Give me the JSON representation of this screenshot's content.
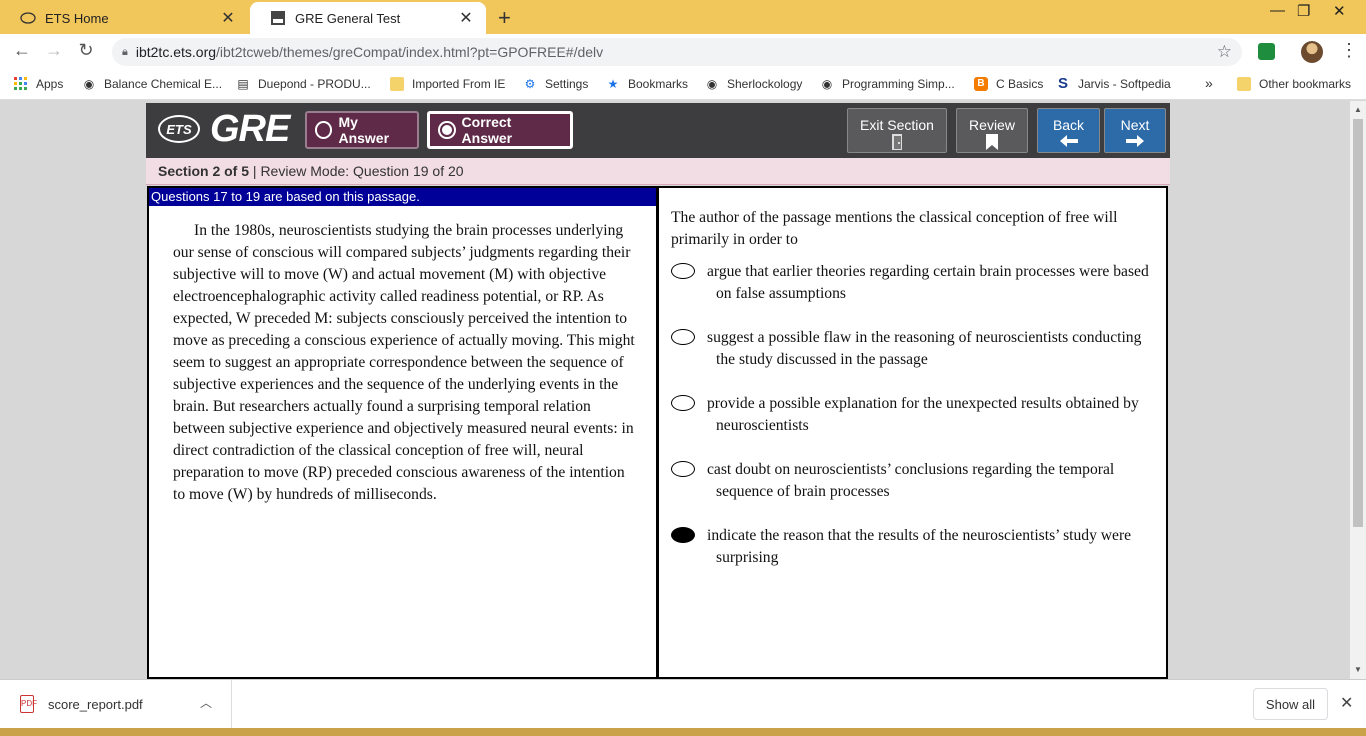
{
  "browser": {
    "tabs": [
      {
        "title": "ETS Home",
        "icon": "ets-icon",
        "active": false
      },
      {
        "title": "GRE General Test",
        "icon": "gre-tab-icon",
        "active": true
      }
    ],
    "url_domain": "ibt2tc.ets.org",
    "url_path": "/ibt2tcweb/themes/greCompat/index.html?pt=GPOFREE#/delv",
    "bookmarks": [
      {
        "label": "Apps",
        "icon": "apps-grid-icon"
      },
      {
        "label": "Balance Chemical E...",
        "icon": "globe-icon"
      },
      {
        "label": "Duepond - PRODU...",
        "icon": "page-icon"
      },
      {
        "label": "Imported From IE",
        "icon": "folder-icon"
      },
      {
        "label": "Settings",
        "icon": "gear-icon"
      },
      {
        "label": "Bookmarks",
        "icon": "star-icon"
      },
      {
        "label": "Sherlockology",
        "icon": "globe-icon"
      },
      {
        "label": "Programming Simp...",
        "icon": "globe-icon"
      },
      {
        "label": "C Basics",
        "icon": "blogger-icon"
      },
      {
        "label": "Jarvis - Softpedia",
        "icon": "softpedia-icon"
      },
      {
        "label": "Other bookmarks",
        "icon": "folder-icon"
      }
    ],
    "overflow_label": "»"
  },
  "test": {
    "logo_ets": "ETS",
    "logo_gre": "GRE",
    "mode_buttons": [
      {
        "label": "My Answer",
        "selected": false
      },
      {
        "label": "Correct Answer",
        "selected": true
      }
    ],
    "nav_buttons": [
      {
        "label": "Exit Section",
        "icon": "door-icon"
      },
      {
        "label": "Review",
        "icon": "bookmark-icon"
      },
      {
        "label": "Back",
        "icon": "arrow-left-icon"
      },
      {
        "label": "Next",
        "icon": "arrow-right-icon"
      }
    ],
    "section_label": "Section 2 of 5",
    "section_mode": " | Review Mode: Question 19 of 20"
  },
  "passage": {
    "header": "Questions 17 to 19 are based on this passage.",
    "text": "In the 1980s, neuroscientists studying the brain processes underlying our sense of conscious will compared subjects’ judgments regarding their subjective will to move (W) and actual movement (M) with objective electroencephalographic activity called readiness potential, or RP. As expected, W preceded M: subjects consciously perceived the intention to move as preceding a conscious experience of actually moving. This might seem to suggest an appropriate correspondence between the sequence of subjective experiences and the sequence of the underlying events in the brain. But researchers actually found a surprising temporal relation between subjective experience and objectively measured neural events: in direct contradiction of the classical conception of free will, neural preparation to move (RP) preceded conscious awareness of the intention to move (W) by hundreds of milliseconds."
  },
  "question": {
    "stem": "The author of the passage mentions the classical conception of free will primarily in order to",
    "choices": [
      {
        "text": "argue that earlier theories regarding certain brain processes were based on false assumptions",
        "selected": false
      },
      {
        "text": "suggest a possible flaw in the reasoning of neuroscientists conducting the study discussed in the passage",
        "selected": false
      },
      {
        "text": "provide a possible explanation for the unexpected results obtained by neuroscientists",
        "selected": false
      },
      {
        "text": "cast doubt on neuroscientists’ conclusions regarding the temporal sequence of brain processes",
        "selected": false
      },
      {
        "text": "indicate the reason that the results of the neuroscientists’ study were surprising",
        "selected": true
      }
    ]
  },
  "downloads": {
    "file_name": "score_report.pdf",
    "file_icon": "pdf-icon",
    "show_all": "Show all"
  },
  "colors": {
    "tabstrip": "#f1c65b",
    "header": "#3d3d3f",
    "mode_button": "#5e2a47",
    "nav_blue": "#2d6aa8",
    "section_bar": "#f2dde4",
    "passage_header": "#000099"
  }
}
